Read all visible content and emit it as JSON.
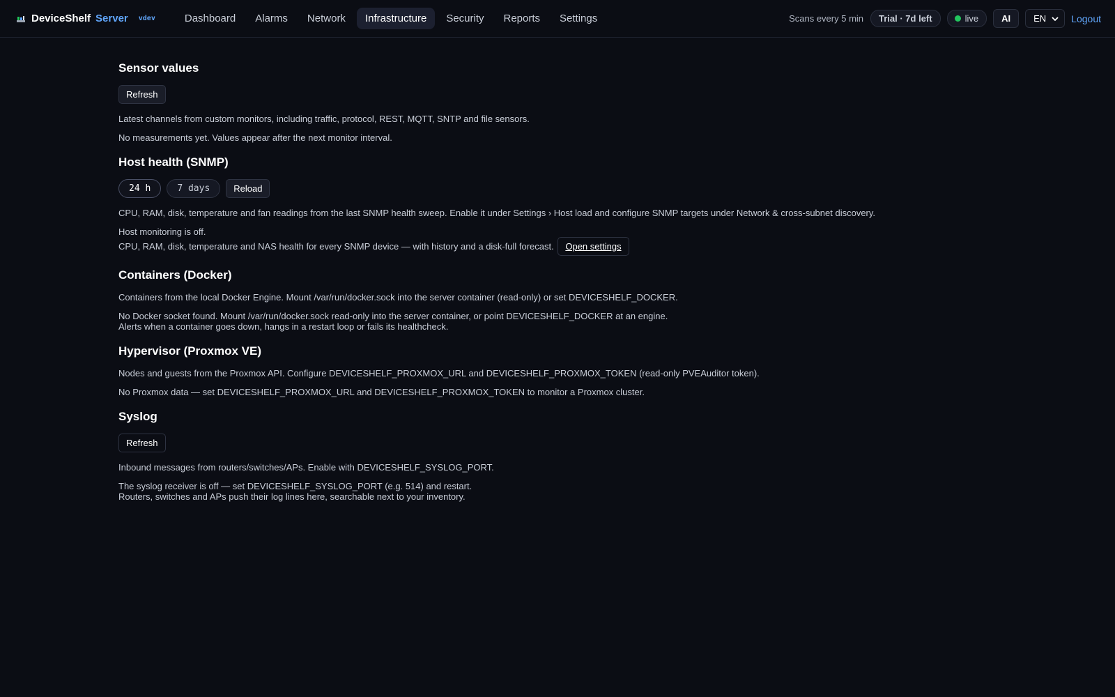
{
  "header": {
    "brand_name": "DeviceShelf",
    "brand_suffix": "Server",
    "version": "vdev",
    "nav": [
      {
        "label": "Dashboard"
      },
      {
        "label": "Alarms"
      },
      {
        "label": "Network"
      },
      {
        "label": "Infrastructure",
        "active": true
      },
      {
        "label": "Security"
      },
      {
        "label": "Reports"
      },
      {
        "label": "Settings"
      }
    ],
    "scan_text": "Scans every 5 min",
    "trial_badge": "Trial · 7d left",
    "live_label": "live",
    "ai_label": "AI",
    "language": "EN",
    "logout_label": "Logout"
  },
  "sensors": {
    "title": "Sensor values",
    "refresh_label": "Refresh",
    "description": "Latest channels from custom monitors, including traffic, protocol, REST, MQTT, SNTP and file sensors.",
    "empty": "No measurements yet. Values appear after the next monitor interval."
  },
  "host_health": {
    "title": "Host health (SNMP)",
    "range_24h": "24 h",
    "range_7d": "7 days",
    "reload_label": "Reload",
    "description": "CPU, RAM, disk, temperature and fan readings from the last SNMP health sweep. Enable it under Settings › Host load and configure SNMP targets under Network & cross-subnet discovery.",
    "off_line1": "Host monitoring is off.",
    "off_line2": "CPU, RAM, disk, temperature and NAS health for every SNMP device — with history and a disk-full forecast.",
    "open_settings_label": "Open settings"
  },
  "containers": {
    "title": "Containers (Docker)",
    "description": "Containers from the local Docker Engine. Mount /var/run/docker.sock into the server container (read-only) or set DEVICESHELF_DOCKER.",
    "empty_line1": "No Docker socket found. Mount /var/run/docker.sock read-only into the server container, or point DEVICESHELF_DOCKER at an engine.",
    "empty_line2": "Alerts when a container goes down, hangs in a restart loop or fails its healthcheck."
  },
  "hypervisor": {
    "title": "Hypervisor (Proxmox VE)",
    "description": "Nodes and guests from the Proxmox API. Configure DEVICESHELF_PROXMOX_URL and DEVICESHELF_PROXMOX_TOKEN (read-only PVEAuditor token).",
    "empty": "No Proxmox data — set DEVICESHELF_PROXMOX_URL and DEVICESHELF_PROXMOX_TOKEN to monitor a Proxmox cluster."
  },
  "syslog": {
    "title": "Syslog",
    "refresh_label": "Refresh",
    "description": "Inbound messages from routers/switches/APs. Enable with DEVICESHELF_SYSLOG_PORT.",
    "off_line1": "The syslog receiver is off — set DEVICESHELF_SYSLOG_PORT (e.g. 514) and restart.",
    "off_line2": "Routers, switches and APs push their log lines here, searchable next to your inventory."
  },
  "colors": {
    "background": "#0b0d14",
    "accent": "#60a5fa",
    "live": "#22c55e"
  }
}
